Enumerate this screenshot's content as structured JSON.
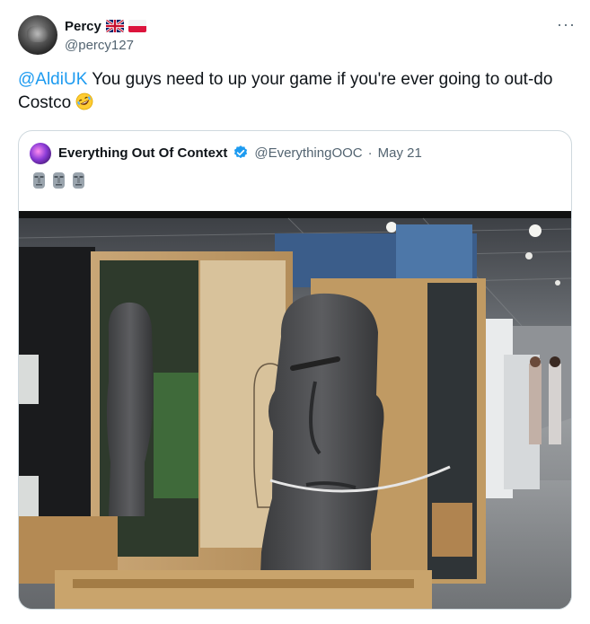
{
  "tweet": {
    "display_name": "Percy",
    "handle": "@percy127",
    "more_label": "···",
    "mention": "@AldiUK",
    "text": " You guys need to up your game if you're ever going to out-do Costco"
  },
  "quote": {
    "display_name": "Everything Out Of Context",
    "handle": "@EverythingOOC",
    "separator": "·",
    "date": "May 21"
  },
  "icons": {
    "flags": [
      "uk-flag-icon",
      "poland-flag-icon"
    ],
    "laugh": "rolling-on-floor-laughing-emoji",
    "verified": "verified-badge-icon",
    "moai": "moai-emoji"
  },
  "colors": {
    "link": "#1d9bf0",
    "secondary_text": "#536471",
    "border": "#cfd9de"
  }
}
